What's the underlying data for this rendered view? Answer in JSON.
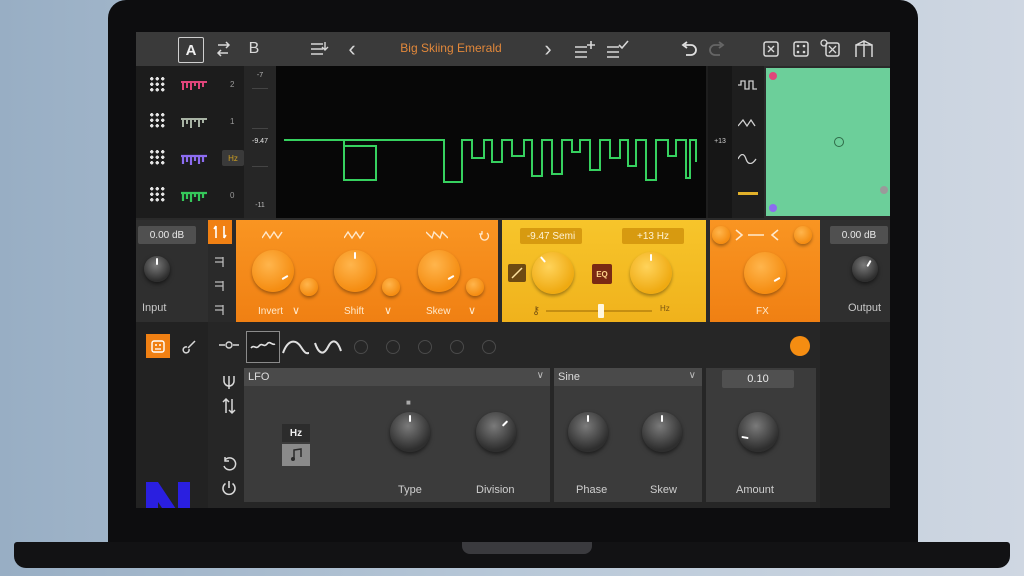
{
  "toolbar": {
    "ab_a": "A",
    "ab_b": "B",
    "preset_name": "Big Skiing Emerald",
    "prev": "‹",
    "next": "›"
  },
  "wave_rows": [
    {
      "number": "2",
      "color": "#e0457a"
    },
    {
      "number": "1",
      "color": "#a8b3a4"
    },
    {
      "number": "",
      "color": "#8c6cf0"
    },
    {
      "number": "0",
      "color": "#35c85a"
    }
  ],
  "hz_tag": "Hz",
  "meter": {
    "top": "-7",
    "value": "-9.47",
    "bottom": "-11"
  },
  "right_meter_value": "+13",
  "input": {
    "db": "0.00 dB",
    "label": "Input"
  },
  "output": {
    "db": "0.00 dB",
    "label": "Output"
  },
  "shape_module": {
    "labels": [
      "Invert",
      "Shift",
      "Skew"
    ]
  },
  "pitch_module": {
    "semi": "-9.47 Semi",
    "hz": "+13 Hz",
    "eq": "EQ",
    "hz_label": "Hz"
  },
  "fx_module": {
    "label": "FX"
  },
  "colors": {
    "accent_orange": "#f58d12",
    "accent_yellow": "#f0b21c",
    "pad_green": "#6ccf9a",
    "trace_green": "#36d15f"
  },
  "lfo": {
    "source": "LFO",
    "unit": "Hz",
    "type_label": "Type",
    "division_label": "Division",
    "waveform": "Sine",
    "phase_label": "Phase",
    "skew_label": "Skew",
    "amount_value": "0.10",
    "amount_label": "Amount"
  }
}
